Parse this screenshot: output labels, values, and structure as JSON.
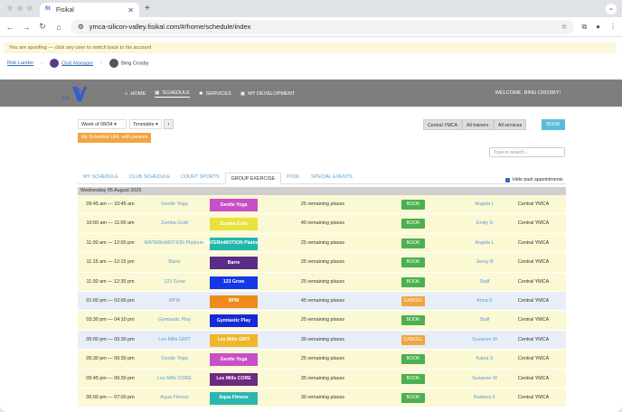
{
  "browser": {
    "tab_title": "Fisikal",
    "favicon_text": "fit",
    "url": "ymca-silicon-valley.fisikal.com/#/home/schedule/index"
  },
  "spoof_banner": "You are spoofing — click any user to switch back to his account",
  "breadcrumb": {
    "user": "Rob Lander",
    "role": "Club Manager",
    "spoofed": "Bing Crosby"
  },
  "nav": {
    "home": "HOME",
    "schedule": "SCHEDULE",
    "services": "SERVICES",
    "development": "MY DEVELOPMENT"
  },
  "welcome": "WELCOME, BING CROSBY!",
  "filters": {
    "week": "Week of 08/04",
    "view": "Timetable",
    "location": "Central YMCA",
    "trainers": "All trainers",
    "services": "All services",
    "book": "BOOK"
  },
  "url_button": "My Schedule URL with params",
  "search_placeholder": "Type to search...",
  "subtabs": [
    "MY SCHEDULE",
    "CLUB SCHEDULE",
    "COURT SPORTS",
    "GROUP EXERCISE",
    "POOL",
    "SPECIAL EVENTS"
  ],
  "hide_past": "Hide past appointments",
  "date_header": "Wednesday 06 August 2025",
  "colors": {
    "gentle": "#c84fc7",
    "zumba": "#e8e23e",
    "water": "#1fb6ae",
    "barre": "#5a2c8a",
    "grow": "#1637e6",
    "rpm": "#f08a1c",
    "gymtastic": "#1629d8",
    "grit": "#efb727",
    "core": "#6b2b80",
    "aqua": "#2bb7b0"
  },
  "classes": [
    {
      "time": "09:45 am — 10:45 am",
      "name": "Gentle Yoga",
      "badge": "Gentle Yoga",
      "color": "#c84fc7",
      "places": "25 remaining places",
      "action": "BOOK",
      "staff": "Angela L",
      "location": "Central YMCA",
      "alt": false
    },
    {
      "time": "10:00 am — 11:00 am",
      "name": "Zumba Gold",
      "badge": "Zumba Gold",
      "color": "#e8e23e",
      "places": "40 remaining places",
      "action": "BOOK",
      "staff": "Emily S",
      "location": "Central YMCA",
      "alt": false
    },
    {
      "time": "11:00 am — 12:00 pm",
      "name": "WATERinMOTION Platinum",
      "badge": "WATERinMOTION Platinum",
      "color": "#1fb6ae",
      "places": "25 remaining places",
      "action": "BOOK",
      "staff": "Angela L",
      "location": "Central YMCA",
      "alt": false
    },
    {
      "time": "11:15 am — 12:15 pm",
      "name": "Barre",
      "badge": "Barre",
      "color": "#5a2c8a",
      "places": "25 remaining places",
      "action": "BOOK",
      "staff": "Jenny B",
      "location": "Central YMCA",
      "alt": false
    },
    {
      "time": "11:30 am — 12:30 pm",
      "name": "123 Grow",
      "badge": "123 Grow",
      "color": "#1637e6",
      "places": "25 remaining places",
      "action": "BOOK",
      "staff": "Staff",
      "location": "Central YMCA",
      "alt": false
    },
    {
      "time": "01:00 pm — 02:00 pm",
      "name": "RPM",
      "badge": "RPM",
      "color": "#f08a1c",
      "places": "45 remaining places",
      "action": "CANCEL",
      "staff": "Anna K",
      "location": "Central YMCA",
      "alt": true
    },
    {
      "time": "03:30 pm — 04:10 pm",
      "name": "Gymtastic Play",
      "badge": "Gymtastic Play",
      "color": "#1629d8",
      "places": "25 remaining places",
      "action": "BOOK",
      "staff": "Staff",
      "location": "Central YMCA",
      "alt": false
    },
    {
      "time": "05:00 pm — 05:30 pm",
      "name": "Les Mills GRIT",
      "badge": "Les Mills GRIT",
      "color": "#efb727",
      "places": "39 remaining places",
      "action": "CANCEL",
      "staff": "Suzanne W",
      "location": "Central YMCA",
      "alt": true
    },
    {
      "time": "05:30 pm — 06:30 pm",
      "name": "Gentle Yoga",
      "badge": "Gentle Yoga",
      "color": "#c84fc7",
      "places": "25 remaining places",
      "action": "BOOK",
      "staff": "Katya S",
      "location": "Central YMCA",
      "alt": false
    },
    {
      "time": "05:45 pm — 06:30 pm",
      "name": "Les Mills CORE",
      "badge": "Les Mills CORE",
      "color": "#6b2b80",
      "places": "35 remaining places",
      "action": "BOOK",
      "staff": "Suzanne W",
      "location": "Central YMCA",
      "alt": false
    },
    {
      "time": "06:00 pm — 07:00 pm",
      "name": "Aqua Fitness",
      "badge": "Aqua Fitness",
      "color": "#2bb7b0",
      "places": "30 remaining places",
      "action": "BOOK",
      "staff": "Barbara F",
      "location": "Central YMCA",
      "alt": false
    }
  ]
}
